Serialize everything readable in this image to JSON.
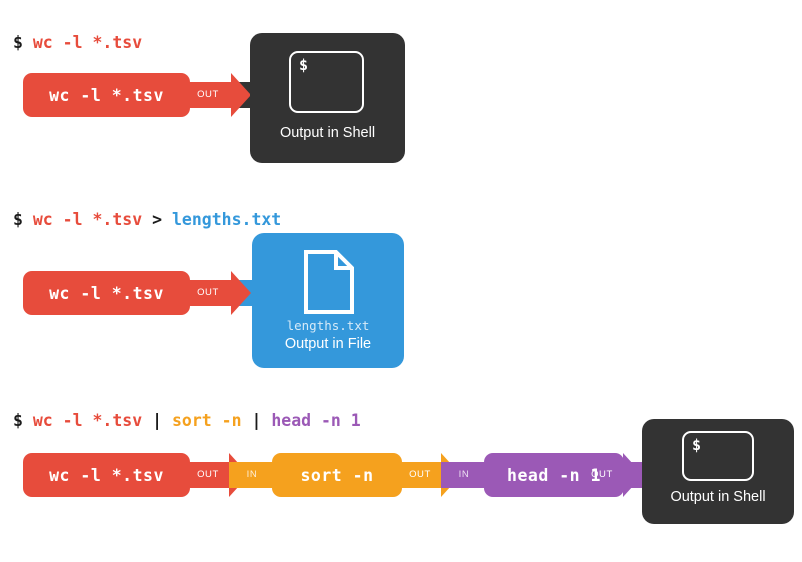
{
  "colors": {
    "background": "#ffffff",
    "red": "#e74c3c",
    "orange": "#f5a11e",
    "purple": "#9b59b6",
    "blue": "#3498db",
    "dark": "#333333",
    "text_dark": "#1b1b1b",
    "white": "#ffffff"
  },
  "labels": {
    "out": "OUT",
    "in": "IN",
    "prompt": "$",
    "dollar": "$"
  },
  "diagram1": {
    "command_line": {
      "prompt": "$",
      "tokens": [
        {
          "text": "wc -l *.tsv",
          "color": "#e74c3c"
        }
      ],
      "full_text": "$ wc -l *.tsv"
    },
    "blocks": [
      {
        "label": "wc -l *.tsv",
        "color": "#e74c3c",
        "out_port": "OUT"
      }
    ],
    "output": {
      "kind": "shell",
      "label": "Output in Shell",
      "glyph_text": "$",
      "color": "#333333"
    }
  },
  "diagram2": {
    "command_line": {
      "prompt": "$",
      "tokens": [
        {
          "text": "wc -l *.tsv",
          "color": "#e74c3c"
        },
        {
          "text": ">",
          "color": "#1b1b1b"
        },
        {
          "text": "lengths.txt",
          "color": "#3498db"
        }
      ],
      "full_text": "$ wc -l *.tsv > lengths.txt"
    },
    "blocks": [
      {
        "label": "wc -l *.tsv",
        "color": "#e74c3c",
        "out_port": "OUT"
      }
    ],
    "output": {
      "kind": "file",
      "label": "Output in File",
      "filename": "lengths.txt",
      "color": "#3498db"
    }
  },
  "diagram3": {
    "command_line": {
      "prompt": "$",
      "tokens": [
        {
          "text": "wc -l *.tsv",
          "color": "#e74c3c"
        },
        {
          "text": "|",
          "color": "#1b1b1b"
        },
        {
          "text": "sort -n",
          "color": "#f5a11e"
        },
        {
          "text": "|",
          "color": "#1b1b1b"
        },
        {
          "text": "head -n 1",
          "color": "#9b59b6"
        }
      ],
      "full_text": "$ wc -l *.tsv | sort -n | head -n 1"
    },
    "blocks": [
      {
        "label": "wc -l *.tsv",
        "color": "#e74c3c",
        "in_port": null,
        "out_port": "OUT"
      },
      {
        "label": "sort -n",
        "color": "#f5a11e",
        "in_port": "IN",
        "out_port": "OUT"
      },
      {
        "label": "head -n 1",
        "color": "#9b59b6",
        "in_port": "IN",
        "out_port": "OUT"
      }
    ],
    "output": {
      "kind": "shell",
      "label": "Output in Shell",
      "glyph_text": "$",
      "color": "#333333"
    }
  }
}
